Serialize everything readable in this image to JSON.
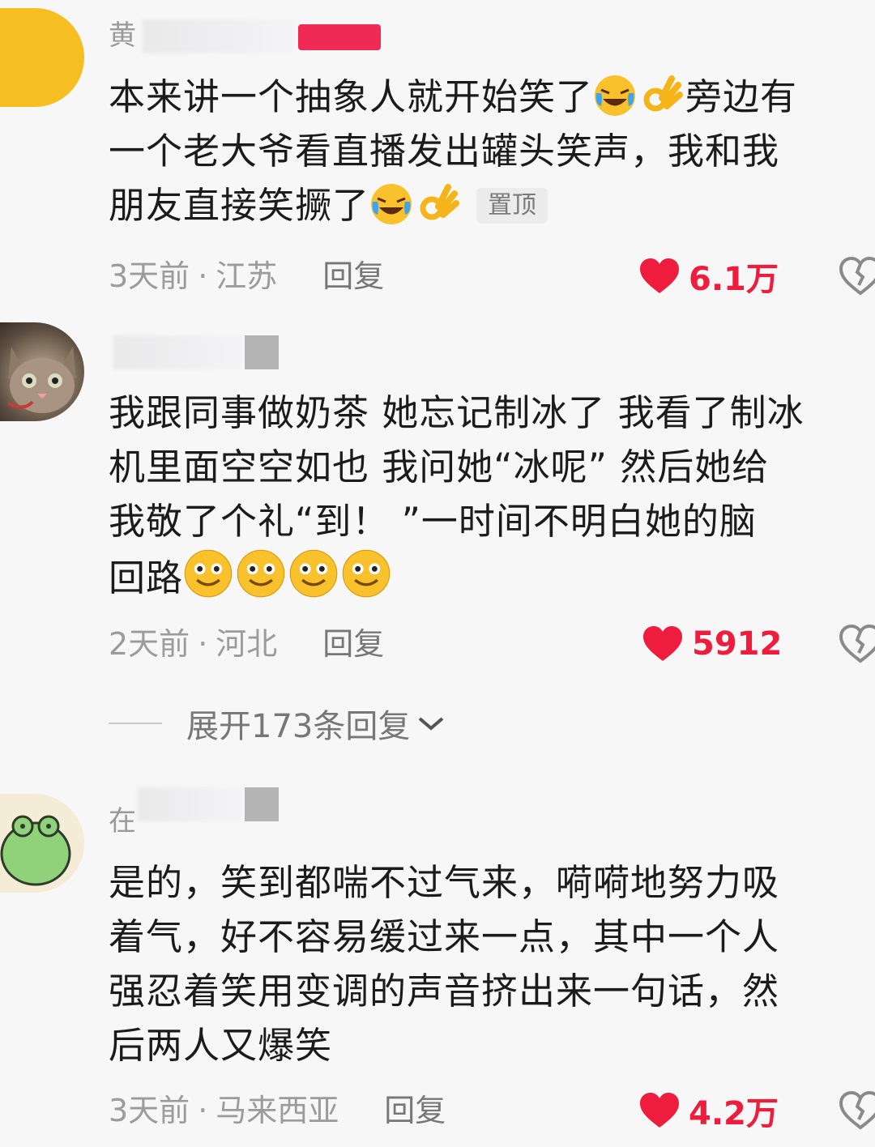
{
  "comments": [
    {
      "username": "黄",
      "lines": [
        "本来讲一个抽象人就开始笑了",
        "旁边有",
        "一个老大爷看直播发出罐头笑声，我和我",
        "朋友直接笑撅了"
      ],
      "pinned_label": "置顶",
      "time": "3天前",
      "location": "江苏",
      "reply_label": "回复",
      "likes": "6.1万"
    },
    {
      "username": "",
      "lines": [
        "我跟同事做奶茶 她忘记制冰了 我看了制冰",
        "机里面空空如也 我问她“冰呢” 然后她给",
        "我敬了个礼“到！ ”一时间不明白她的脑",
        "回路"
      ],
      "time": "2天前",
      "location": "河北",
      "reply_label": "回复",
      "likes": "5912"
    },
    {
      "username": "在",
      "lines": [
        "是的，笑到都喘不过气来，嗬嗬地努力吸",
        "着气，好不容易缓过来一点，其中一个人",
        "强忍着笑用变调的声音挤出来一句话，然",
        "后两人又爆笑"
      ],
      "time": "3天前",
      "location": "马来西亚",
      "reply_label": "回复",
      "likes": "4.2万"
    }
  ],
  "expand_replies": "展开173条回复",
  "colors": {
    "like": "#ee1d3d",
    "meta": "#9b9b9b",
    "background": "#f7f7f7"
  }
}
